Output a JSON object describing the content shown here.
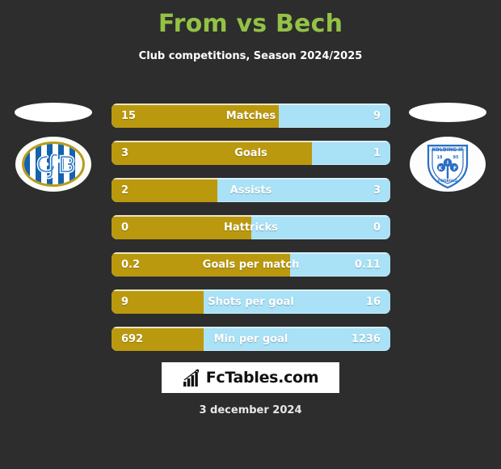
{
  "header": {
    "title": "From vs Bech",
    "subtitle": "Club competitions, Season 2024/2025",
    "title_color": "#93c246"
  },
  "crests": {
    "left": {
      "name": "EfB",
      "alt": "Esbjerg fB crest",
      "letters": "EfB"
    },
    "right": {
      "name": "Kolding IF",
      "alt": "Kolding IF crest",
      "arc_text": "KOLDING IF",
      "year_left": "18",
      "year_right": "95",
      "bottom_text": "FODBOLD",
      "letters": "KIF"
    }
  },
  "colors": {
    "background": "#2d2d2d",
    "home_bar": "#bb990e",
    "away_bar": "#a9e1f6",
    "value_text": "#ffffff"
  },
  "footer": {
    "logo_text": "FcTables.com",
    "logo_icon": "bar-chart-icon",
    "date": "3 december 2024"
  },
  "chart_data": {
    "type": "bar",
    "title": "From vs Bech",
    "subtitle": "Club competitions, Season 2024/2025",
    "orientation": "horizontal-diverging",
    "legend": [
      "From",
      "Bech"
    ],
    "series": [
      {
        "name": "From",
        "color": "#bb990e",
        "values": [
          15,
          3,
          2,
          0,
          0.2,
          9,
          692
        ]
      },
      {
        "name": "Bech",
        "color": "#a9e1f6",
        "values": [
          9,
          1,
          3,
          0,
          0.11,
          16,
          1236
        ]
      }
    ],
    "categories": [
      "Matches",
      "Goals",
      "Assists",
      "Hattricks",
      "Goals per match",
      "Shots per goal",
      "Min per goal"
    ],
    "rows": [
      {
        "label": "Matches",
        "home": "15",
        "away": "9",
        "home_pct": 60
      },
      {
        "label": "Goals",
        "home": "3",
        "away": "1",
        "home_pct": 72
      },
      {
        "label": "Assists",
        "home": "2",
        "away": "3",
        "home_pct": 38
      },
      {
        "label": "Hattricks",
        "home": "0",
        "away": "0",
        "home_pct": 50
      },
      {
        "label": "Goals per match",
        "home": "0.2",
        "away": "0.11",
        "home_pct": 64
      },
      {
        "label": "Shots per goal",
        "home": "9",
        "away": "16",
        "home_pct": 33
      },
      {
        "label": "Min per goal",
        "home": "692",
        "away": "1236",
        "home_pct": 33
      }
    ],
    "xlabel": "",
    "ylabel": "",
    "grid": false
  }
}
